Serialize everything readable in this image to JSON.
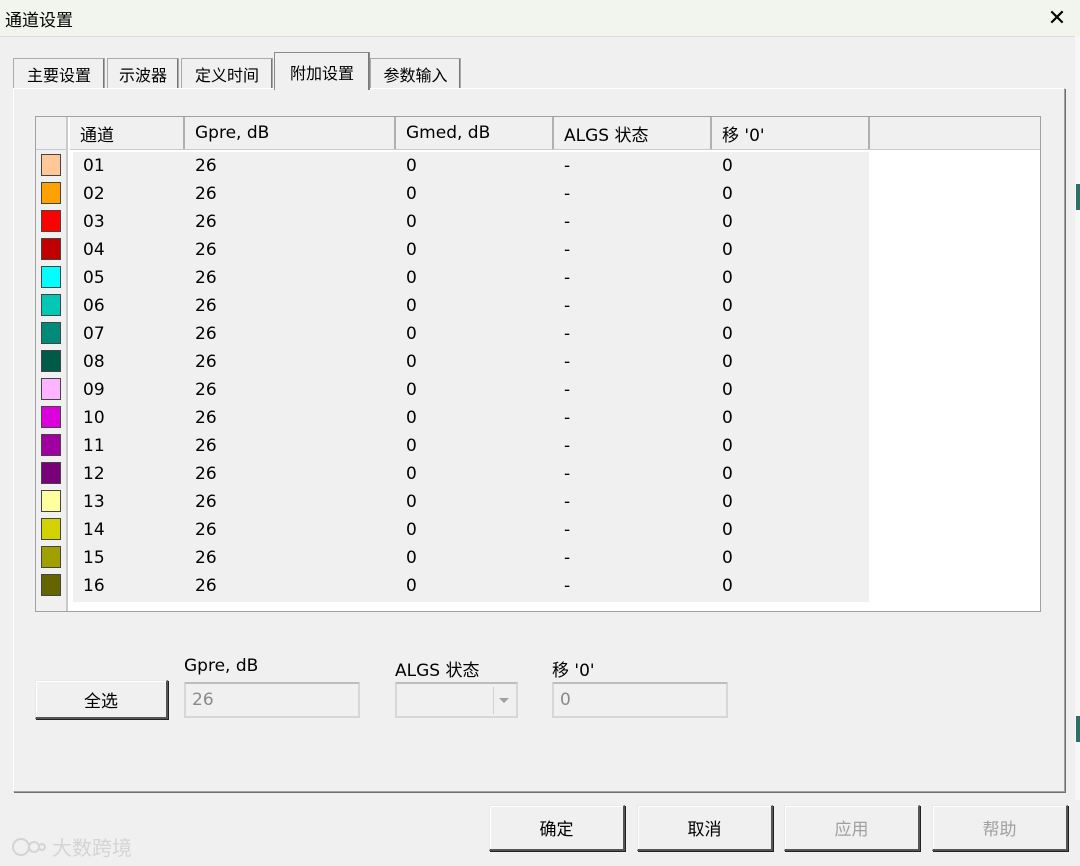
{
  "window": {
    "title": "通道设置",
    "close_glyph": "✕"
  },
  "tabs": [
    {
      "label": "主要设置",
      "active": false
    },
    {
      "label": "示波器",
      "active": false
    },
    {
      "label": "定义时间",
      "active": false
    },
    {
      "label": "附加设置",
      "active": true
    },
    {
      "label": "参数输入",
      "active": false
    }
  ],
  "grid": {
    "headers": [
      "通道",
      "Gpre, dB",
      "Gmed, dB",
      "ALGS 状态",
      "移 '0'"
    ],
    "rows": [
      {
        "channel": "01",
        "gpre": "26",
        "gmed": "0",
        "algs": "-",
        "shift": "0",
        "color": "#ffc898"
      },
      {
        "channel": "02",
        "gpre": "26",
        "gmed": "0",
        "algs": "-",
        "shift": "0",
        "color": "#ffa200"
      },
      {
        "channel": "03",
        "gpre": "26",
        "gmed": "0",
        "algs": "-",
        "shift": "0",
        "color": "#ff0000"
      },
      {
        "channel": "04",
        "gpre": "26",
        "gmed": "0",
        "algs": "-",
        "shift": "0",
        "color": "#c00000"
      },
      {
        "channel": "05",
        "gpre": "26",
        "gmed": "0",
        "algs": "-",
        "shift": "0",
        "color": "#00ffff"
      },
      {
        "channel": "06",
        "gpre": "26",
        "gmed": "0",
        "algs": "-",
        "shift": "0",
        "color": "#00c8b4"
      },
      {
        "channel": "07",
        "gpre": "26",
        "gmed": "0",
        "algs": "-",
        "shift": "0",
        "color": "#008a78"
      },
      {
        "channel": "08",
        "gpre": "26",
        "gmed": "0",
        "algs": "-",
        "shift": "0",
        "color": "#005a48"
      },
      {
        "channel": "09",
        "gpre": "26",
        "gmed": "0",
        "algs": "-",
        "shift": "0",
        "color": "#ffb4ff"
      },
      {
        "channel": "10",
        "gpre": "26",
        "gmed": "0",
        "algs": "-",
        "shift": "0",
        "color": "#dc00dc"
      },
      {
        "channel": "11",
        "gpre": "26",
        "gmed": "0",
        "algs": "-",
        "shift": "0",
        "color": "#a000a0"
      },
      {
        "channel": "12",
        "gpre": "26",
        "gmed": "0",
        "algs": "-",
        "shift": "0",
        "color": "#780078"
      },
      {
        "channel": "13",
        "gpre": "26",
        "gmed": "0",
        "algs": "-",
        "shift": "0",
        "color": "#ffffa0"
      },
      {
        "channel": "14",
        "gpre": "26",
        "gmed": "0",
        "algs": "-",
        "shift": "0",
        "color": "#d2d200"
      },
      {
        "channel": "15",
        "gpre": "26",
        "gmed": "0",
        "algs": "-",
        "shift": "0",
        "color": "#a0a000"
      },
      {
        "channel": "16",
        "gpre": "26",
        "gmed": "0",
        "algs": "-",
        "shift": "0",
        "color": "#646400"
      }
    ]
  },
  "editor": {
    "select_all_label": "全选",
    "gpre_label": "Gpre, dB",
    "gpre_value": "26",
    "algs_label": "ALGS 状态",
    "algs_value": "",
    "shift_label": "移 '0'",
    "shift_value": "0"
  },
  "footer": {
    "ok_label": "确定",
    "cancel_label": "取消",
    "apply_label": "应用",
    "help_label": "帮助"
  },
  "watermark": {
    "text": "大数跨境"
  },
  "colors": {
    "window_bg": "#f0f0f0",
    "disabled_text": "#a0a0a0",
    "titlebar_bg": "#f2f4ee"
  }
}
